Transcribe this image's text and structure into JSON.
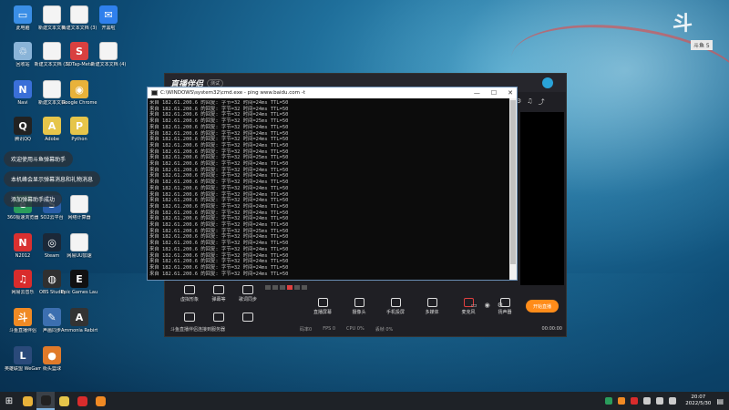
{
  "desktop": {
    "icons": [
      {
        "label": "此电脑",
        "color": "#3a8ee6",
        "glyph": "▭"
      },
      {
        "label": "新建文本文档",
        "color": "#f4f4f4",
        "glyph": ""
      },
      {
        "label": "新建文本文档 (3)",
        "color": "#f4f4f4",
        "glyph": ""
      },
      {
        "label": "开黑啦",
        "color": "#2f80ed",
        "glyph": "✉"
      },
      {
        "label": "回收站",
        "color": "#8ab4d8",
        "glyph": "♲"
      },
      {
        "label": "新建文本文档 (2)",
        "color": "#f4f4f4",
        "glyph": ""
      },
      {
        "label": "SDTap-Meta",
        "color": "#d94040",
        "glyph": "S"
      },
      {
        "label": "新建文本文档 (4)",
        "color": "#f4f4f4",
        "glyph": ""
      },
      {
        "label": "Navi",
        "color": "#3a6fd8",
        "glyph": "N"
      },
      {
        "label": "新建文本文档",
        "color": "#f4f4f4",
        "glyph": ""
      },
      {
        "label": "Google Chrome",
        "color": "#e8b23a",
        "glyph": "◉"
      },
      {
        "label": "腾讯QQ",
        "color": "#222222",
        "glyph": "Q"
      },
      {
        "label": "Adobe",
        "color": "#e6c54a",
        "glyph": "A"
      },
      {
        "label": "Python",
        "color": "#e6c54a",
        "glyph": "P"
      },
      {
        "label": "360极速浏览器",
        "color": "#2a9d5c",
        "glyph": "e"
      },
      {
        "label": "SO2云平台",
        "color": "#2a5ea8",
        "glyph": "S"
      },
      {
        "label": "网络计算器",
        "color": "#f4f4f4",
        "glyph": ""
      },
      {
        "label": "N2012",
        "color": "#d93030",
        "glyph": "N"
      },
      {
        "label": "Steam",
        "color": "#1b2838",
        "glyph": "◎"
      },
      {
        "label": "网易UU加速",
        "color": "#f4f4f4",
        "glyph": ""
      },
      {
        "label": "网易云音乐",
        "color": "#d92c2c",
        "glyph": "♫"
      },
      {
        "label": "OBS Studio",
        "color": "#303030",
        "glyph": "◍"
      },
      {
        "label": "Epic Games Launcher",
        "color": "#111111",
        "glyph": "E"
      },
      {
        "label": "斗鱼直播伴侣",
        "color": "#f08a24",
        "glyph": "斗"
      },
      {
        "label": "声画同步",
        "color": "#3c6fb0",
        "glyph": "✎"
      },
      {
        "label": "Ammonia Rebirth",
        "color": "#333333",
        "glyph": "A"
      },
      {
        "label": "英雄联盟 WeGame版",
        "color": "#2a4a7a",
        "glyph": "L"
      },
      {
        "label": "街头篮球",
        "color": "#e07a2a",
        "glyph": "●"
      }
    ],
    "notices": [
      "欢迎使用斗鱼弹幕助手",
      "本机峰会显示弹幕消息和礼物消息",
      "添加弹幕助手成功"
    ],
    "widget_caption": "斗鱼  5"
  },
  "app": {
    "logo": "直播伴侣",
    "version": "测试",
    "buttons": [
      "虚拟形象",
      "弹幕等",
      "歌词同步",
      "",
      "",
      ""
    ],
    "tools": [
      "直播屏幕",
      "摄像头",
      "手机投屏",
      "多媒体",
      "麦克风",
      "扬声器"
    ],
    "go_live": "开始直播",
    "status": {
      "message": "斗鱼直播伴侣连接到服务器",
      "items": [
        "码率0",
        "FPS 0",
        "CPU 0%",
        "丢帧 0%"
      ],
      "time": "00:00:00"
    }
  },
  "cmd": {
    "title": "C:\\WINDOWS\\system32\\cmd.exe - ping  www.baidu.com -t",
    "lines": [
      "来自 182.61.200.6 的回复: 字节=32 时间=24ms TTL=50",
      "来自 182.61.200.6 的回复: 字节=32 时间=24ms TTL=50",
      "来自 182.61.200.6 的回复: 字节=32 时间=24ms TTL=50",
      "来自 182.61.200.6 的回复: 字节=32 时间=25ms TTL=50",
      "来自 182.61.200.6 的回复: 字节=32 时间=24ms TTL=50",
      "来自 182.61.200.6 的回复: 字节=32 时间=24ms TTL=50",
      "来自 182.61.200.6 的回复: 字节=32 时间=24ms TTL=50",
      "来自 182.61.200.6 的回复: 字节=32 时间=24ms TTL=50",
      "来自 182.61.200.6 的回复: 字节=32 时间=24ms TTL=50",
      "来自 182.61.200.6 的回复: 字节=32 时间=25ms TTL=50",
      "来自 182.61.200.6 的回复: 字节=32 时间=24ms TTL=50",
      "来自 182.61.200.6 的回复: 字节=32 时间=24ms TTL=50",
      "来自 182.61.200.6 的回复: 字节=32 时间=24ms TTL=50",
      "来自 182.61.200.6 的回复: 字节=32 时间=24ms TTL=50",
      "来自 182.61.200.6 的回复: 字节=32 时间=24ms TTL=50",
      "来自 182.61.200.6 的回复: 字节=32 时间=24ms TTL=50",
      "来自 182.61.200.6 的回复: 字节=32 时间=24ms TTL=50",
      "来自 182.61.200.6 的回复: 字节=32 时间=24ms TTL=50",
      "来自 182.61.200.6 的回复: 字节=32 时间=24ms TTL=50",
      "来自 182.61.200.6 的回复: 字节=32 时间=24ms TTL=50",
      "来自 182.61.200.6 的回复: 字节=32 时间=24ms TTL=50",
      "来自 182.61.200.6 的回复: 字节=32 时间=25ms TTL=50",
      "来自 182.61.200.6 的回复: 字节=32 时间=24ms TTL=50",
      "来自 182.61.200.6 的回复: 字节=32 时间=24ms TTL=50",
      "来自 182.61.200.6 的回复: 字节=32 时间=24ms TTL=50",
      "来自 182.61.200.6 的回复: 字节=32 时间=24ms TTL=50",
      "来自 182.61.200.6 的回复: 字节=32 时间=24ms TTL=50",
      "来自 182.61.200.6 的回复: 字节=32 时间=24ms TTL=50",
      "来自 182.61.200.6 的回复: 字节=32 时间=24ms TTL=50"
    ]
  },
  "taskbar": {
    "items": [
      {
        "name": "chrome",
        "color": "#e8b23a",
        "active": false
      },
      {
        "name": "cmd",
        "color": "#222222",
        "active": true
      },
      {
        "name": "folder",
        "color": "#e6c54a",
        "active": false
      },
      {
        "name": "netease-music",
        "color": "#d92c2c",
        "active": false
      },
      {
        "name": "douyu",
        "color": "#f08a24",
        "active": false
      }
    ],
    "time": "20:07",
    "date": "2022/5/30"
  }
}
